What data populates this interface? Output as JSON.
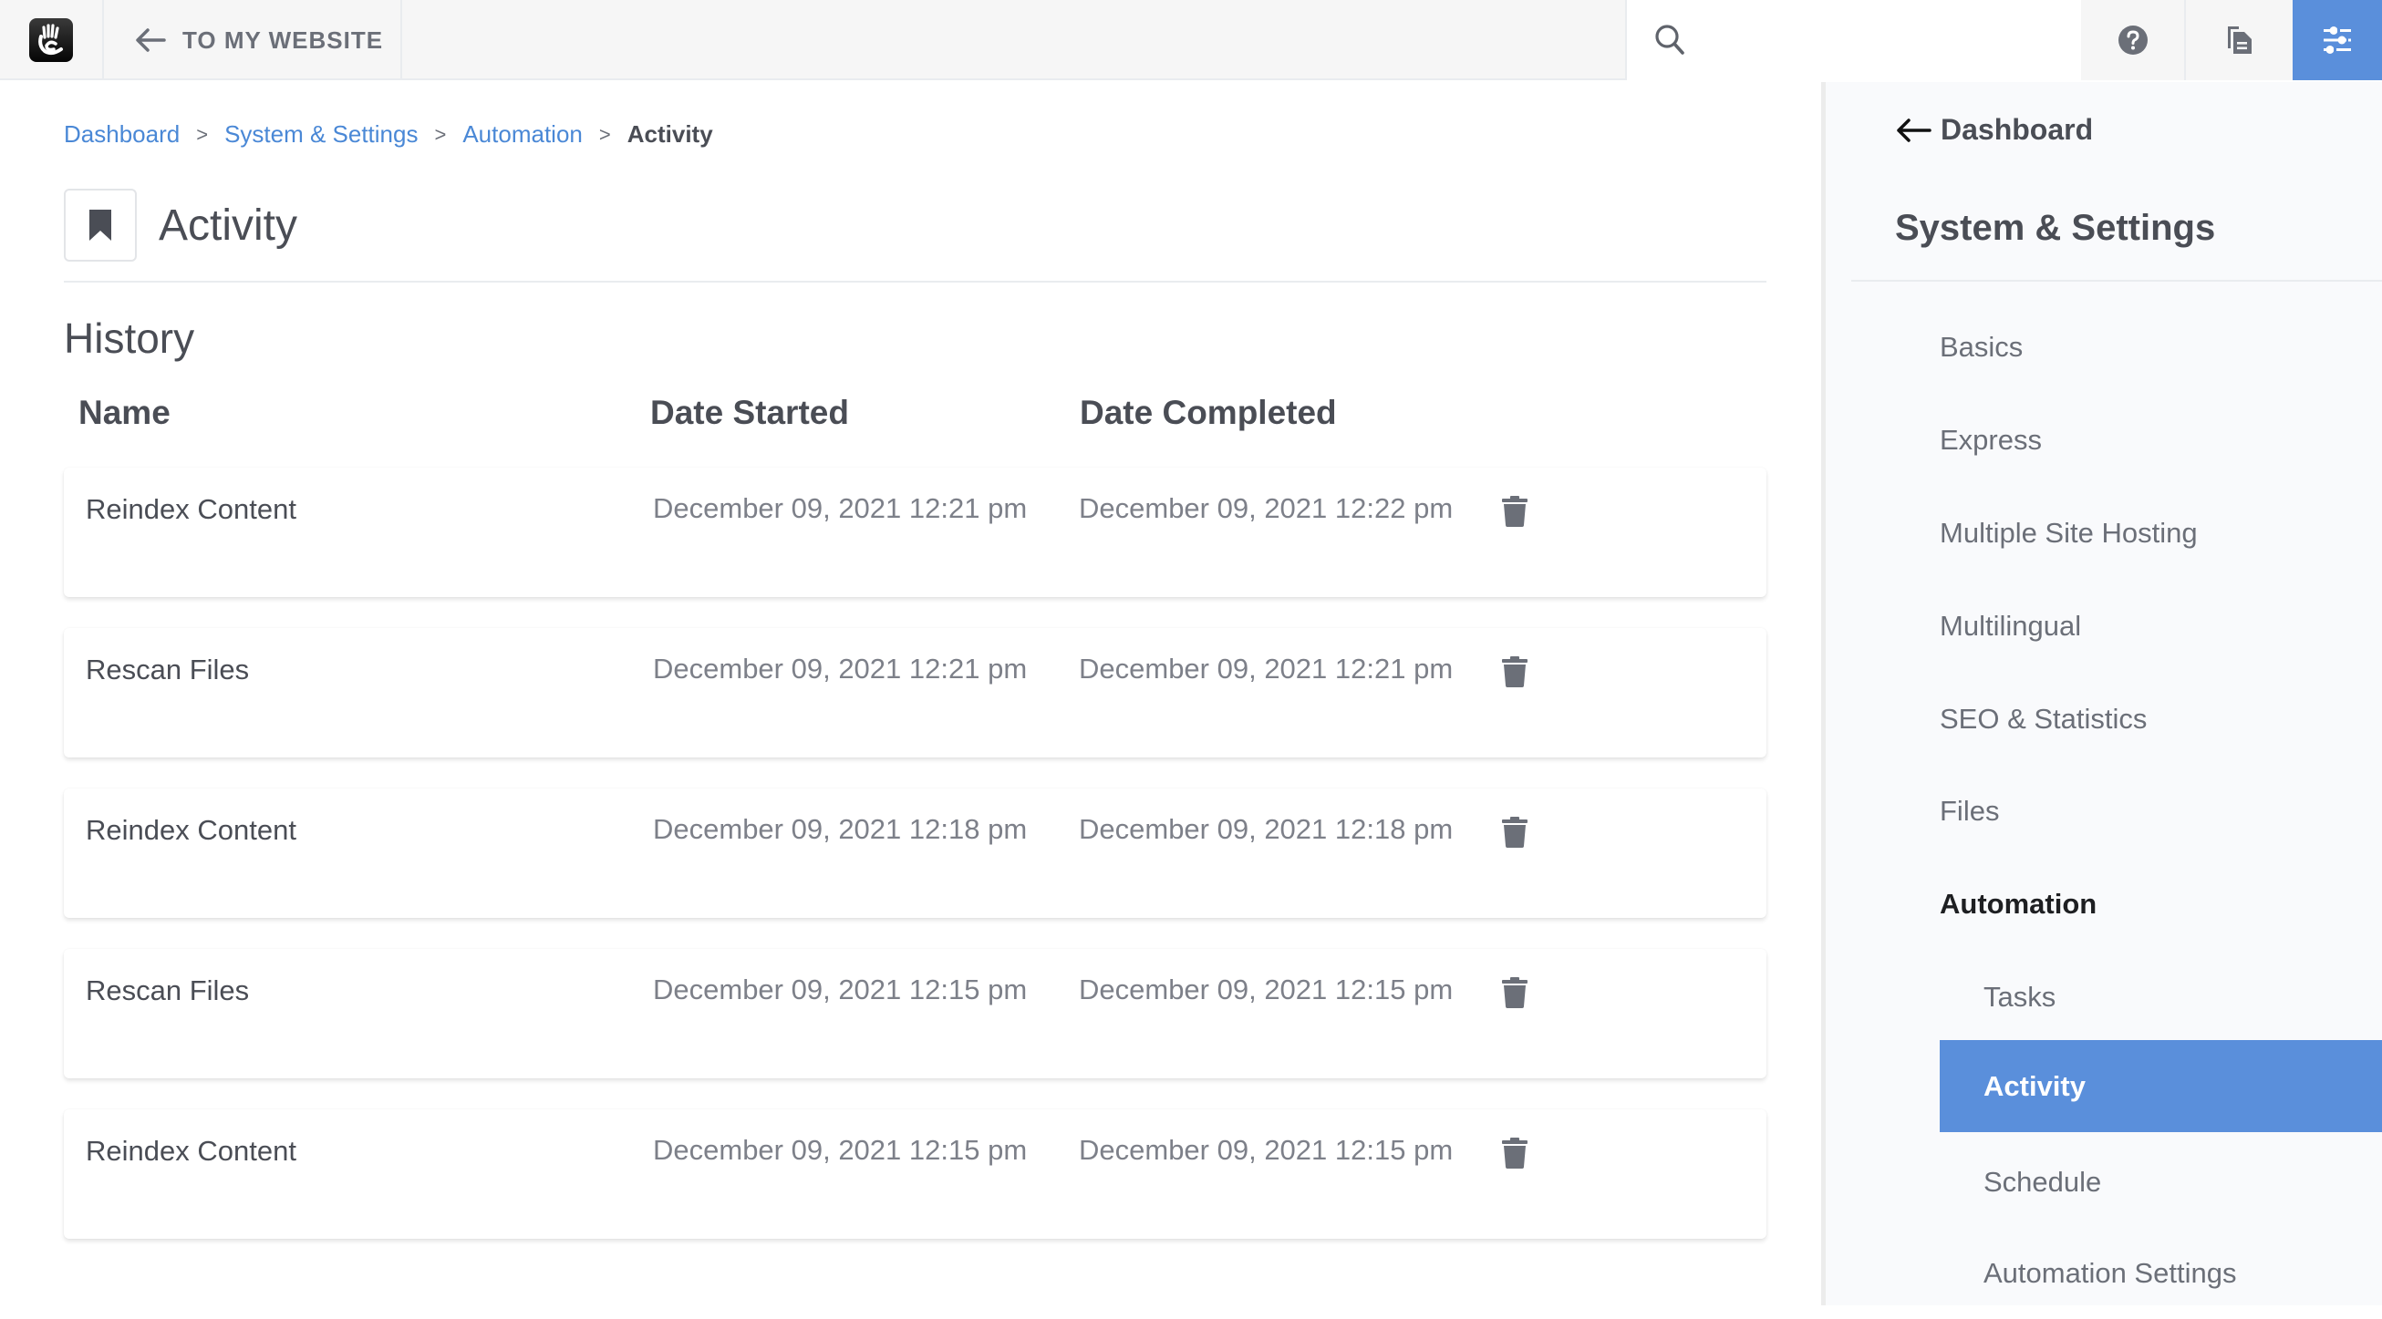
{
  "topbar": {
    "logo_icon": "concrete-hand-logo",
    "back_link": "To my website",
    "search_placeholder": "",
    "search_value": "",
    "help_icon": "question-circle-icon",
    "pages_icon": "copy-file-icon",
    "settings_icon": "sliders-icon",
    "accent": "#5a8fdb"
  },
  "breadcrumb": [
    {
      "label": "Dashboard"
    },
    {
      "label": "System & Settings"
    },
    {
      "label": "Automation"
    },
    {
      "label": "Activity"
    }
  ],
  "breadcrumb_separator": ">",
  "page": {
    "title": "Activity",
    "title_icon": "bookmark-icon",
    "section_title": "History"
  },
  "table": {
    "columns": [
      "Name",
      "Date Started",
      "Date Completed"
    ],
    "rows": [
      {
        "name": "Reindex Content",
        "started": "December 09, 2021 12:21 pm",
        "completed": "December 09, 2021 12:22 pm"
      },
      {
        "name": "Rescan Files",
        "started": "December 09, 2021 12:21 pm",
        "completed": "December 09, 2021 12:21 pm"
      },
      {
        "name": "Reindex Content",
        "started": "December 09, 2021 12:18 pm",
        "completed": "December 09, 2021 12:18 pm"
      },
      {
        "name": "Rescan Files",
        "started": "December 09, 2021 12:15 pm",
        "completed": "December 09, 2021 12:15 pm"
      },
      {
        "name": "Reindex Content",
        "started": "December 09, 2021 12:15 pm",
        "completed": "December 09, 2021 12:15 pm"
      }
    ],
    "row_action_icon": "trash-icon"
  },
  "sidebar": {
    "back_label": "Dashboard",
    "title": "System & Settings",
    "items": [
      {
        "label": "Basics",
        "level": 1,
        "state": "normal"
      },
      {
        "label": "Express",
        "level": 1,
        "state": "normal"
      },
      {
        "label": "Multiple Site Hosting",
        "level": 1,
        "state": "normal"
      },
      {
        "label": "Multilingual",
        "level": 1,
        "state": "normal"
      },
      {
        "label": "SEO & Statistics",
        "level": 1,
        "state": "normal"
      },
      {
        "label": "Files",
        "level": 1,
        "state": "normal"
      },
      {
        "label": "Automation",
        "level": 1,
        "state": "open"
      },
      {
        "label": "Tasks",
        "level": 2,
        "state": "normal"
      },
      {
        "label": "Activity",
        "level": 2,
        "state": "active"
      },
      {
        "label": "Schedule",
        "level": 2,
        "state": "normal"
      },
      {
        "label": "Automation Settings",
        "level": 2,
        "state": "normal"
      }
    ]
  }
}
